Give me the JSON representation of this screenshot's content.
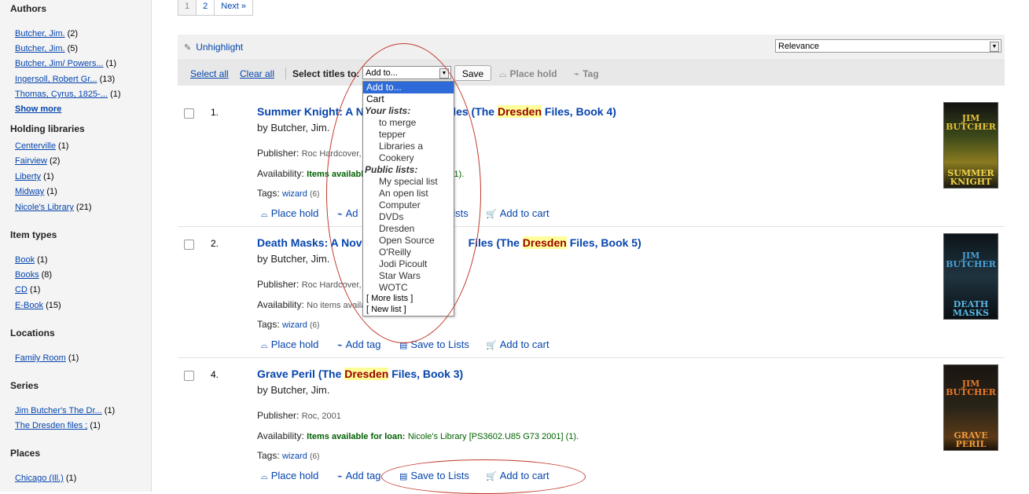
{
  "sidebar": {
    "authors_heading": "Authors",
    "authors": [
      {
        "name": "Butcher, Jim.",
        "count": "(2)"
      },
      {
        "name": "Butcher, Jim.",
        "count": "(5)"
      },
      {
        "name": "Butcher, Jim/ Powers...",
        "count": "(1)"
      },
      {
        "name": "Ingersoll, Robert Gr...",
        "count": "(13)"
      },
      {
        "name": "Thomas, Cyrus, 1825-...",
        "count": "(1)"
      }
    ],
    "show_more": "Show more",
    "libraries_heading": "Holding libraries",
    "libraries": [
      {
        "name": "Centerville",
        "count": "(1)"
      },
      {
        "name": "Fairview",
        "count": "(2)"
      },
      {
        "name": "Liberty",
        "count": "(1)"
      },
      {
        "name": "Midway",
        "count": "(1)"
      },
      {
        "name": "Nicole's Library",
        "count": "(21)"
      }
    ],
    "itemtypes_heading": "Item types",
    "itemtypes": [
      {
        "name": "Book",
        "count": "(1)"
      },
      {
        "name": "Books",
        "count": "(8)"
      },
      {
        "name": "CD",
        "count": "(1)"
      },
      {
        "name": "E-Book",
        "count": "(15)"
      }
    ],
    "locations_heading": "Locations",
    "locations": [
      {
        "name": "Family Room",
        "count": "(1)"
      }
    ],
    "series_heading": "Series",
    "series": [
      {
        "name": "Jim Butcher's The Dr...",
        "count": "(1)"
      },
      {
        "name": "The Dresden files ;",
        "count": "(1)"
      }
    ],
    "places_heading": "Places",
    "places": [
      {
        "name": "Chicago (Ill.)",
        "count": "(1)"
      }
    ]
  },
  "pager": {
    "page1": "1",
    "page2": "2",
    "next": "Next »"
  },
  "toolbar": {
    "unhighlight": "Unhighlight",
    "sort_value": "Relevance",
    "select_all": "Select all",
    "clear_all": "Clear all",
    "select_titles_label": "Select titles to:",
    "addto_value": "Add to...",
    "save": "Save",
    "place_hold": "Place hold",
    "tag": "Tag"
  },
  "dropdown": {
    "selected": "Add to...",
    "cart": "Cart",
    "your_lists_label": "Your lists:",
    "your_lists": [
      "to merge",
      "tepper",
      "Libraries a",
      "Cookery"
    ],
    "public_lists_label": "Public lists:",
    "public_lists": [
      "My special list",
      "An open list",
      "Computer",
      "DVDs",
      "Dresden",
      "Open Source",
      "O'Reilly",
      "Jodi Picoult",
      "Star Wars",
      "WOTC"
    ],
    "more_lists": "[ More lists ]",
    "new_list": "[ New list ]"
  },
  "results": [
    {
      "number": "1.",
      "title_pre": "Summer Knight: A N",
      "title_mid": " Files (The ",
      "title_hl": "Dresden",
      "title_post": " Files, Book 4)",
      "by": "by Butcher, Jim.",
      "publisher_label": "Publisher:",
      "publisher": "Roc Hardcover,",
      "availability_label": "Availability:",
      "availability_status": "Items available",
      "availability_tail": "ary (1).",
      "tags_label": "Tags:",
      "tag": "wizard",
      "tag_count": "(6)",
      "actions": {
        "place_hold": "Place hold",
        "add_tag": "Ad",
        "save_lists": "Lists",
        "add_cart": "Add to cart"
      },
      "cover": {
        "author": "JIM BUTCHER",
        "title": "SUMMER KNIGHT",
        "color": "#3d4a1a"
      }
    },
    {
      "number": "2.",
      "title_pre": "Death Masks: A Nov",
      "title_mid": "Files (The ",
      "title_hl": "Dresden",
      "title_post": " Files, Book 5)",
      "by": "by Butcher, Jim.",
      "publisher_label": "Publisher:",
      "publisher": "Roc Hardcover,",
      "availability_label": "Availability:",
      "availability_status": "No items availa",
      "tags_label": "Tags:",
      "tag": "wizard",
      "tag_count": "(6)",
      "actions": {
        "place_hold": "Place hold",
        "add_tag": "Add tag",
        "save_lists": "Save to Lists",
        "add_cart": "Add to cart"
      },
      "cover": {
        "author": "JIM BUTCHER",
        "title": "DEATH MASKS",
        "color": "#1f3440"
      }
    },
    {
      "number": "4.",
      "title_pre": "Grave Peril (The ",
      "title_hl": "Dresden",
      "title_post": " Files, Book 3)",
      "by": "by Butcher, Jim.",
      "publisher_label": "Publisher:",
      "publisher": "Roc, 2001",
      "availability_label": "Availability:",
      "availability_status": "Items available for loan:",
      "availability_detail": "Nicole's Library [PS3602.U85 G73 2001] (1).",
      "tags_label": "Tags:",
      "tag": "wizard",
      "tag_count": "(6)",
      "actions": {
        "place_hold": "Place hold",
        "add_tag": "Add tag",
        "save_lists": "Save to Lists",
        "add_cart": "Add to cart"
      },
      "cover": {
        "author": "JIM BUTCHER",
        "title": "GRAVE PERIL",
        "color": "#2a2418"
      }
    }
  ],
  "colors": {
    "link": "#0645ad",
    "highlight_bg": "#ffff99",
    "highlight_fg": "#990000",
    "available": "#006100",
    "annotation": "#c0392b",
    "selection": "#2f6bd8"
  }
}
